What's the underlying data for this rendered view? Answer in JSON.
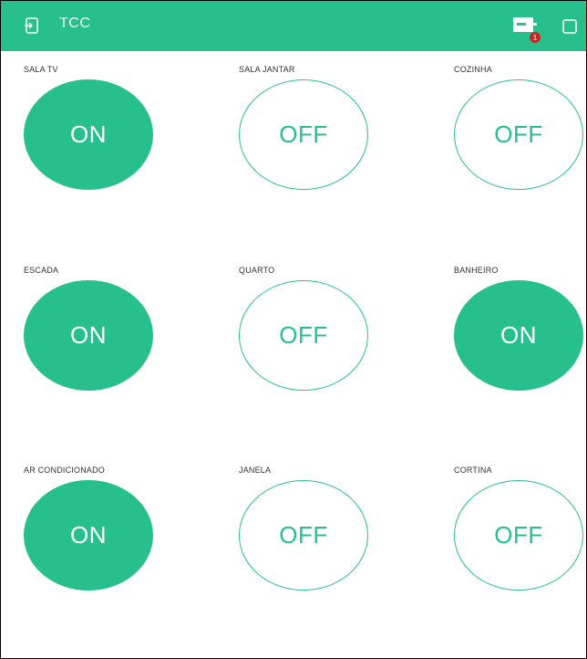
{
  "header": {
    "title": "TCC",
    "notification_count": "1",
    "accent": "#27c08c"
  },
  "buttons": [
    {
      "label": "SALA TV",
      "state": "ON"
    },
    {
      "label": "SALA JANTAR",
      "state": "OFF"
    },
    {
      "label": "COZINHA",
      "state": "OFF"
    },
    {
      "label": "ESCADA",
      "state": "ON"
    },
    {
      "label": "QUARTO",
      "state": "OFF"
    },
    {
      "label": "BANHEIRO",
      "state": "ON"
    },
    {
      "label": "AR CONDICIONADO",
      "state": "ON"
    },
    {
      "label": "JANELA",
      "state": "OFF"
    },
    {
      "label": "CORTINA",
      "state": "OFF"
    }
  ]
}
